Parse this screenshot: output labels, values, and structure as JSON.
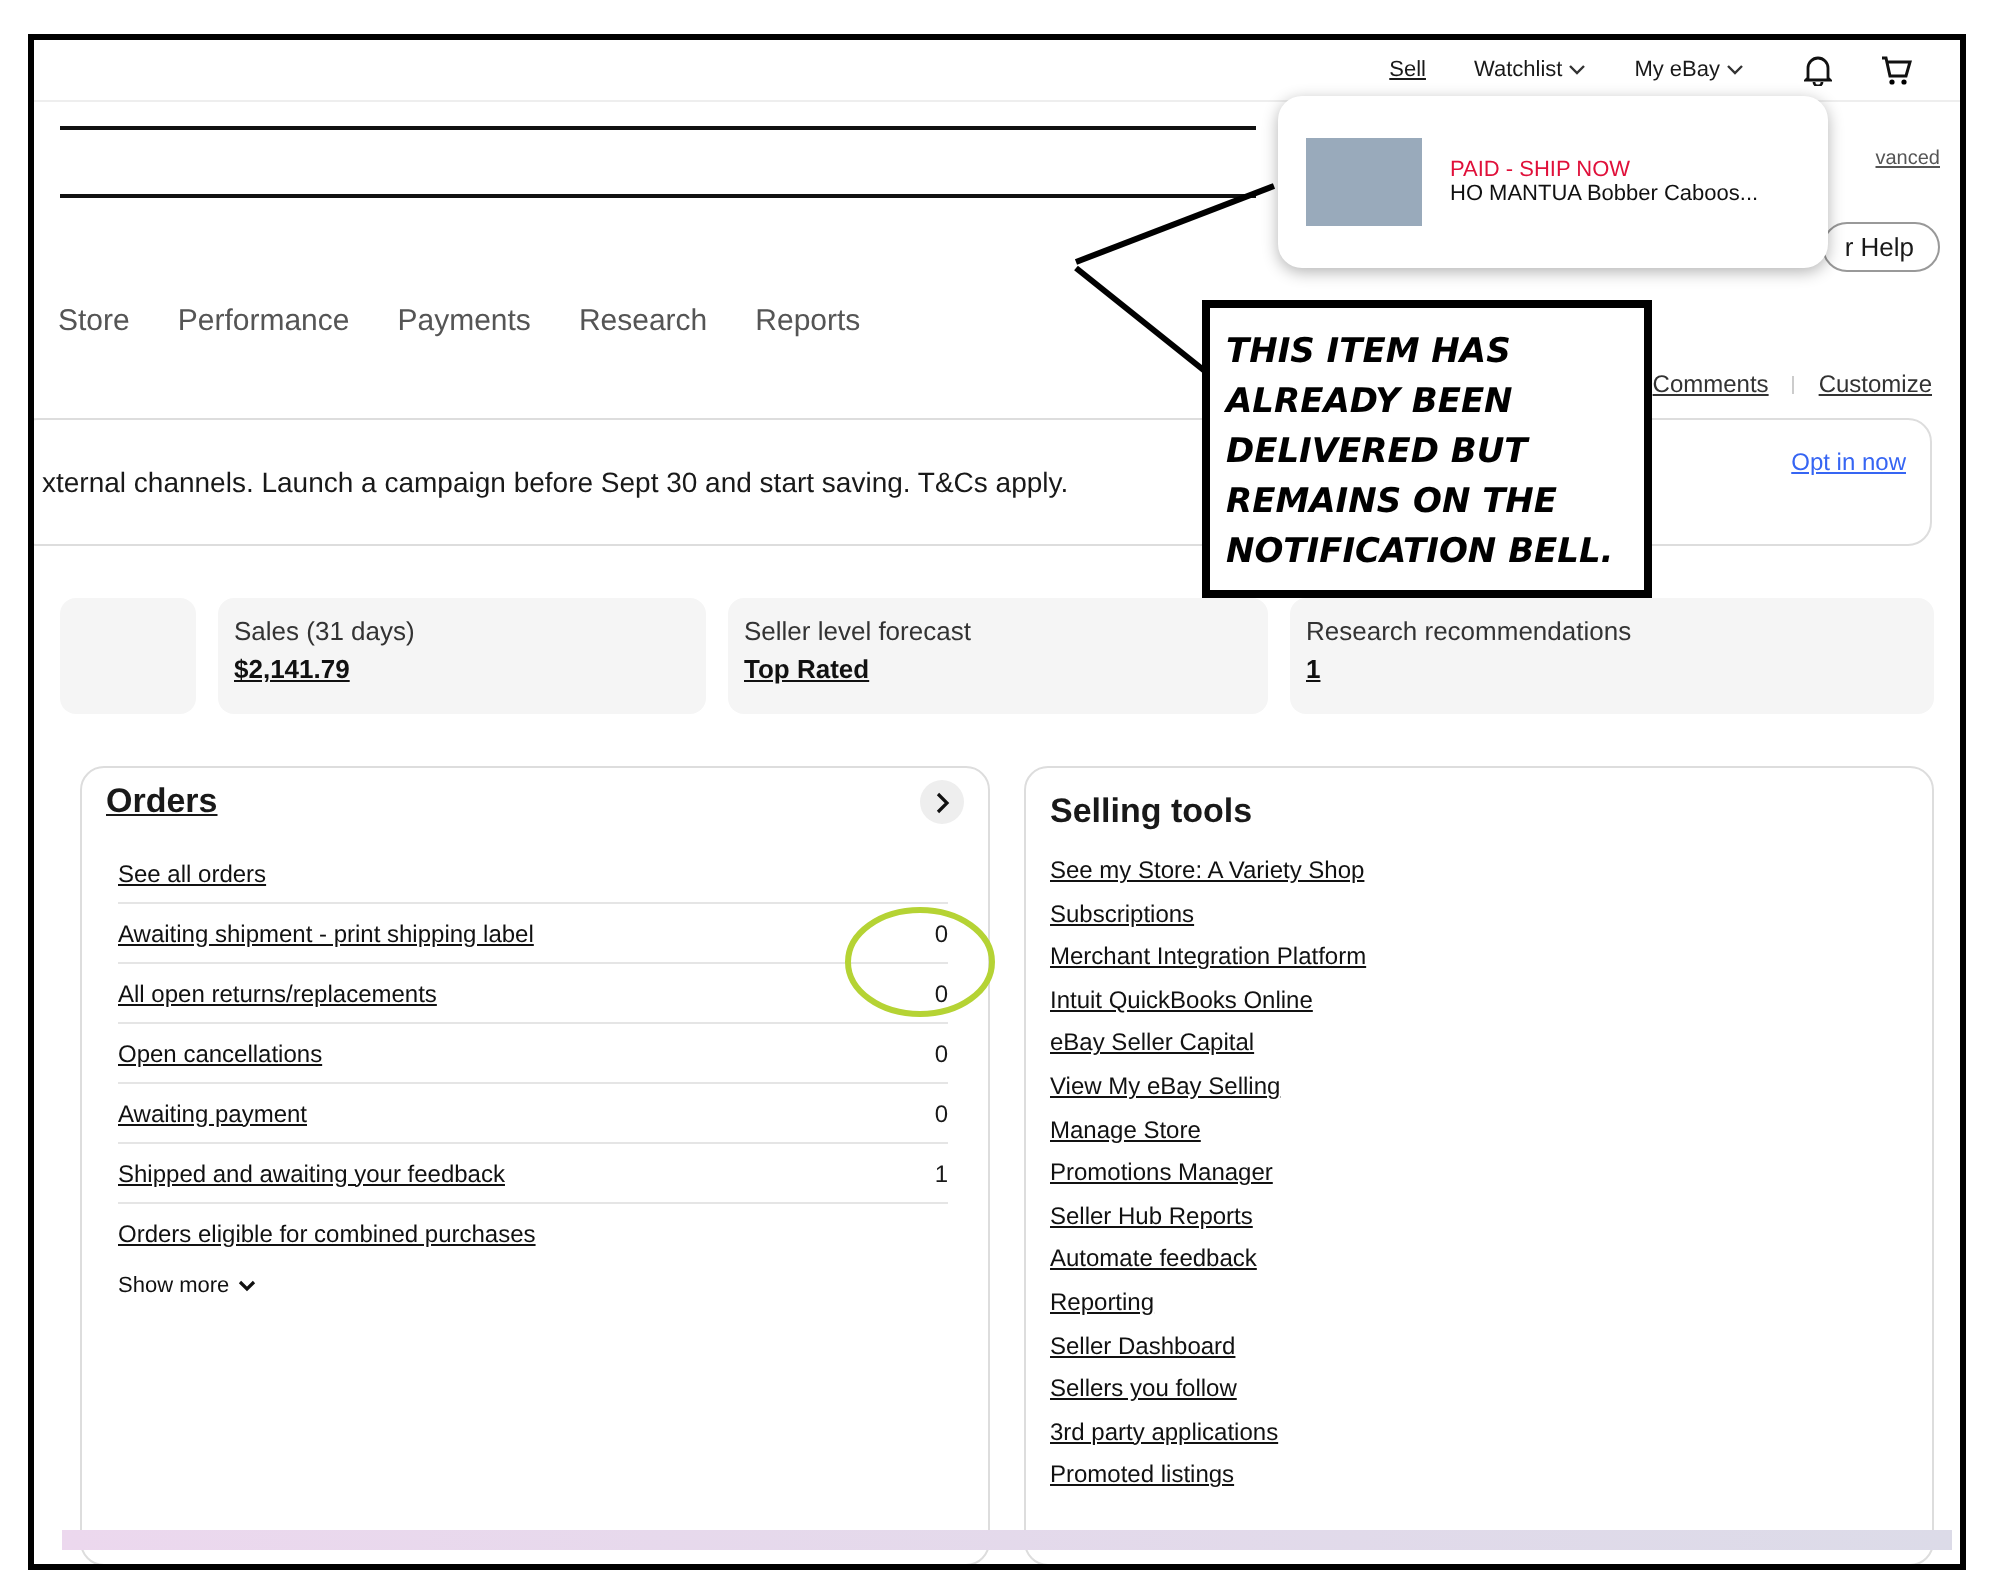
{
  "top_nav": {
    "links": [
      {
        "label": "Sell",
        "kind": "link"
      },
      {
        "label": "Watchlist",
        "kind": "menu"
      },
      {
        "label": "My eBay",
        "kind": "menu"
      }
    ]
  },
  "notification_popup": {
    "status": "PAID - SHIP NOW",
    "title": "HO MANTUA Bobber Caboos..."
  },
  "search": {
    "advanced_link": "vanced",
    "help_button": "r Help"
  },
  "tabs": [
    {
      "label": "Store"
    },
    {
      "label": "Performance"
    },
    {
      "label": "Payments"
    },
    {
      "label": "Research"
    },
    {
      "label": "Reports"
    }
  ],
  "page_links": [
    "Comments",
    "Customize"
  ],
  "banner": {
    "text": "xternal channels. Launch a campaign before Sept 30 and start saving. T&Cs apply.",
    "link": "Opt in now"
  },
  "summary_cards": [
    {
      "label": "Sales (31 days)",
      "value": "$2,141.79"
    },
    {
      "label": "Seller level forecast",
      "value": "Top Rated"
    },
    {
      "label": "Research recommendations",
      "value": "1"
    }
  ],
  "orders": {
    "title": "Orders",
    "rows": [
      {
        "label": "See all orders"
      },
      {
        "label": "Awaiting shipment - print shipping label",
        "count": "0"
      },
      {
        "label": "All open returns/replacements",
        "count": "0"
      },
      {
        "label": "Open cancellations",
        "count": "0"
      },
      {
        "label": "Awaiting payment",
        "count": "0"
      },
      {
        "label": "Shipped and awaiting your feedback",
        "count": "1"
      },
      {
        "label": "Orders eligible for combined purchases"
      }
    ],
    "show_more": "Show more"
  },
  "selling_tools": {
    "title": "Selling tools",
    "links": [
      "See my Store: A Variety Shop",
      "Subscriptions",
      "Merchant Integration Platform",
      "Intuit QuickBooks Online",
      "eBay Seller Capital",
      "View My eBay Selling",
      "Manage Store",
      "Promotions Manager",
      "Seller Hub Reports",
      "Automate feedback",
      "Reporting",
      "Seller Dashboard",
      "Sellers you follow",
      "3rd party applications",
      "Promoted listings"
    ]
  },
  "annotation": {
    "text": "THIS ITEM HAS ALREADY BEEN DELIVERED BUT REMAINS ON THE NOTIFICATION BELL."
  }
}
